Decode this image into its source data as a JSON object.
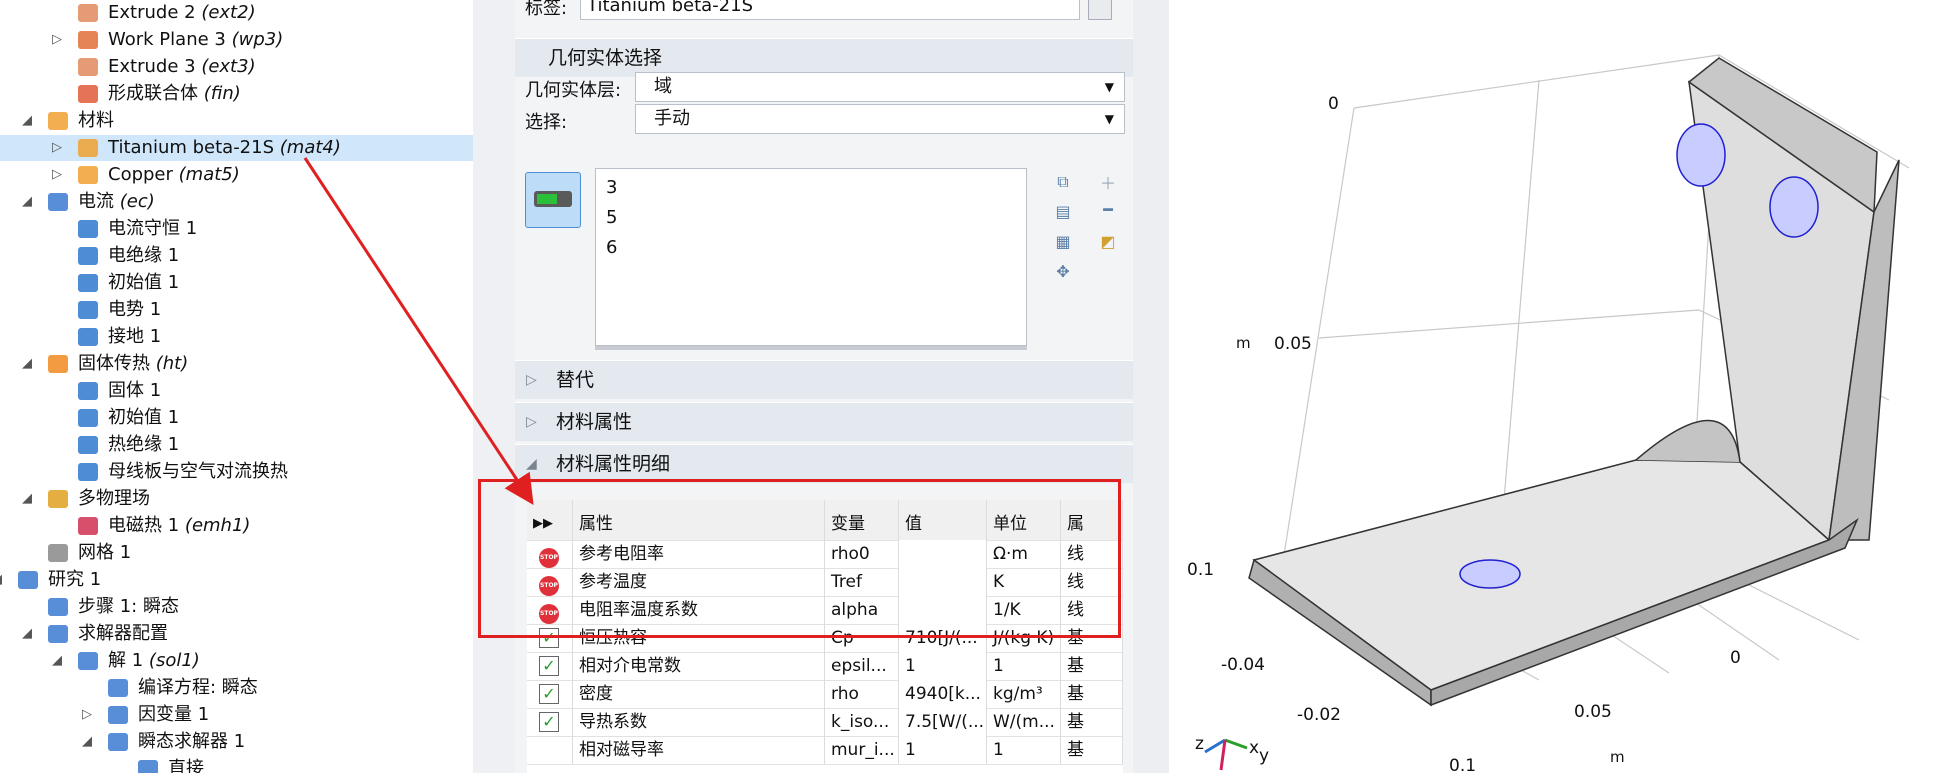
{
  "tree": {
    "items": [
      {
        "label": "Extrude 2",
        "tag": "(ext2)",
        "icon": "extrude-icon",
        "color": "#e08a5a"
      },
      {
        "label": "Work Plane 3",
        "tag": "(wp3)",
        "icon": "work-plane-icon",
        "color": "#e0703a"
      },
      {
        "label": "Extrude 3",
        "tag": "(ext3)",
        "icon": "extrude-icon",
        "color": "#e08a5a"
      },
      {
        "label": "形成联合体",
        "tag": "(fin)",
        "icon": "form-union-icon",
        "color": "#e05a3a"
      },
      {
        "label": "材料",
        "tag": "",
        "icon": "materials-icon",
        "color": "#f0a030"
      },
      {
        "label": "Titanium beta-21S",
        "tag": "(mat4)",
        "icon": "material-icon",
        "color": "#f0a030"
      },
      {
        "label": "Copper",
        "tag": "(mat5)",
        "icon": "material-icon",
        "color": "#f0a030"
      },
      {
        "label": "电流",
        "tag": "(ec)",
        "icon": "electric-currents-icon",
        "color": "#3a7ad0"
      },
      {
        "label": "电流守恒 1",
        "tag": "",
        "icon": "domain-feature-icon",
        "color": "#2f78cf"
      },
      {
        "label": "电绝缘 1",
        "tag": "",
        "icon": "boundary-feature-icon",
        "color": "#2f78cf"
      },
      {
        "label": "初始值 1",
        "tag": "",
        "icon": "domain-feature-icon",
        "color": "#2f78cf"
      },
      {
        "label": "电势 1",
        "tag": "",
        "icon": "boundary-feature-icon",
        "color": "#2f78cf"
      },
      {
        "label": "接地 1",
        "tag": "",
        "icon": "boundary-feature-icon",
        "color": "#2f78cf"
      },
      {
        "label": "固体传热",
        "tag": "(ht)",
        "icon": "heat-transfer-icon",
        "color": "#f08a20"
      },
      {
        "label": "固体 1",
        "tag": "",
        "icon": "domain-feature-icon",
        "color": "#2f78cf"
      },
      {
        "label": "初始值 1",
        "tag": "",
        "icon": "domain-feature-icon",
        "color": "#2f78cf"
      },
      {
        "label": "热绝缘 1",
        "tag": "",
        "icon": "boundary-feature-icon",
        "color": "#2f78cf"
      },
      {
        "label": "母线板与空气对流换热",
        "tag": "",
        "icon": "boundary-feature-icon",
        "color": "#2f78cf"
      },
      {
        "label": "多物理场",
        "tag": "",
        "icon": "multiphysics-icon",
        "color": "#e0a020"
      },
      {
        "label": "电磁热 1",
        "tag": "(emh1)",
        "icon": "electromagnetic-heating-icon",
        "color": "#d03050"
      },
      {
        "label": "网格 1",
        "tag": "",
        "icon": "mesh-icon",
        "color": "#888888"
      },
      {
        "label": "研究 1",
        "tag": "",
        "icon": "study-icon",
        "color": "#3a7ad0"
      },
      {
        "label": "步骤 1: 瞬态",
        "tag": "",
        "icon": "time-dependent-step-icon",
        "color": "#3a7ad0"
      },
      {
        "label": "求解器配置",
        "tag": "",
        "icon": "solver-configurations-icon",
        "color": "#3a7ad0"
      },
      {
        "label": "解 1",
        "tag": "(sol1)",
        "icon": "solution-icon",
        "color": "#3a7ad0"
      },
      {
        "label": "编译方程: 瞬态",
        "tag": "",
        "icon": "compile-equations-icon",
        "color": "#3a7ad0"
      },
      {
        "label": "因变量 1",
        "tag": "",
        "icon": "dependent-variables-icon",
        "color": "#3a7ad0"
      },
      {
        "label": "瞬态求解器 1",
        "tag": "",
        "icon": "time-dependent-solver-icon",
        "color": "#3a7ad0"
      },
      {
        "label": "直接",
        "tag": "",
        "icon": "direct-solver-icon",
        "color": "#3a7ad0"
      }
    ]
  },
  "settings": {
    "label_caption": "标签:",
    "label_value": "Titanium beta-21S",
    "geom_section": "几何实体选择",
    "geom_level_caption": "几何实体层:",
    "geom_level_value": "域",
    "selection_caption": "选择:",
    "selection_value": "手动",
    "selection_items": [
      "3",
      "5",
      "6"
    ],
    "override_section": "替代",
    "material_props_section": "材料属性",
    "material_contents_section": "材料属性明细"
  },
  "table": {
    "headers": [
      "属性",
      "变量",
      "值",
      "单位",
      "属"
    ],
    "rows": [
      {
        "status": "stop",
        "property": "参考电阻率",
        "variable": "rho0",
        "value": "",
        "unit": "Ω·m",
        "group": "线"
      },
      {
        "status": "stop",
        "property": "参考温度",
        "variable": "Tref",
        "value": "",
        "unit": "K",
        "group": "线"
      },
      {
        "status": "stop",
        "property": "电阻率温度系数",
        "variable": "alpha",
        "value": "",
        "unit": "1/K",
        "group": "线"
      },
      {
        "status": "check",
        "property": "恒压热容",
        "variable": "Cp",
        "value": "710[J/(...",
        "unit": "J/(kg·K)",
        "group": "基"
      },
      {
        "status": "check",
        "property": "相对介电常数",
        "variable": "epsil...",
        "value": "1",
        "unit": "1",
        "group": "基"
      },
      {
        "status": "check",
        "property": "密度",
        "variable": "rho",
        "value": "4940[k...",
        "unit": "kg/m³",
        "group": "基"
      },
      {
        "status": "check",
        "property": "导热系数",
        "variable": "k_iso...",
        "value": "7.5[W/(...",
        "unit": "W/(m...",
        "group": "基"
      },
      {
        "status": "",
        "property": "相对磁导率",
        "variable": "mur_i...",
        "value": "1",
        "unit": "1",
        "group": "基"
      }
    ]
  },
  "viewport": {
    "axis_labels": {
      "z_top": "0",
      "z_mid": "0.05",
      "z_low": "0.1",
      "z_unit": "m",
      "x_neg04": "-0.04",
      "x_neg02": "-0.02",
      "y_0": "0",
      "y_005": "0.05",
      "y_01": "0.1",
      "y_unit": "m",
      "triad_z": "z",
      "triad_x": "x",
      "triad_y": "y"
    },
    "colors": {
      "part": "#dcdcdc",
      "highlight": "#c8ccff",
      "highlight_edge": "#2020d0"
    }
  },
  "annotation": {
    "color": "#e02020"
  }
}
